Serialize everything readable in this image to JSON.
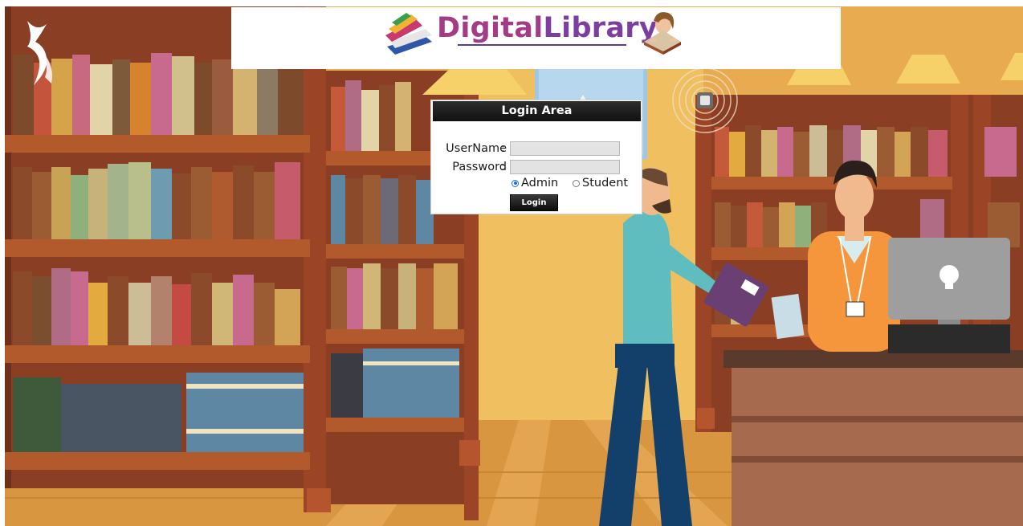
{
  "brand": {
    "title_part1": "Digital",
    "title_part2": "Library"
  },
  "login": {
    "heading": "Login Area",
    "username_label": "UserName",
    "password_label": "Password",
    "colon": ":",
    "username_value": "",
    "password_value": "",
    "roles": [
      {
        "label": "Admin",
        "selected": true
      },
      {
        "label": "Student",
        "selected": false
      }
    ],
    "submit_label": "Login"
  },
  "icons": {
    "site_logo": "sigma-logo-icon",
    "brand_books": "books-icon",
    "brand_reader": "girl-reading-icon"
  },
  "colors": {
    "accent_purple": "#a33b86",
    "login_header": "#111111",
    "background_orange": "#e7a94c",
    "radio_selected": "#1a6fd6"
  }
}
